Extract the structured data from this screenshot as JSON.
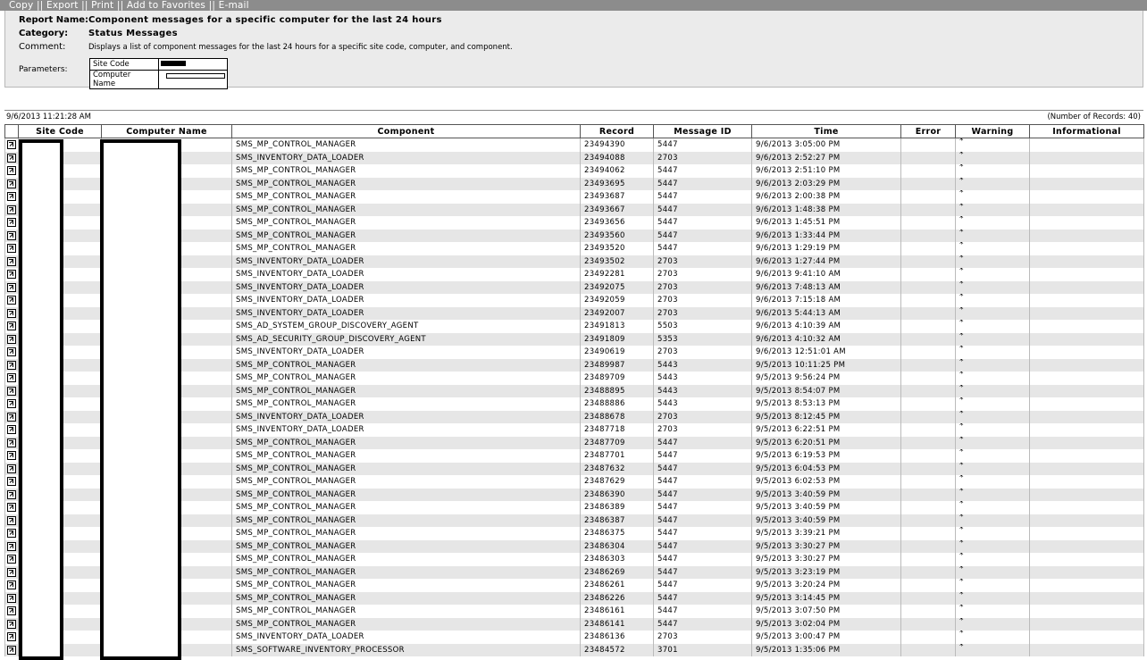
{
  "toolbar": {
    "copy": "Copy",
    "export": "Export",
    "print": "Print",
    "add_to_favorites": "Add to Favorites",
    "email": "E-mail",
    "separator": "||"
  },
  "report": {
    "name_label": "Report Name:",
    "name": "Component messages for a specific computer for the last 24 hours",
    "category_label": "Category:",
    "category": "Status Messages",
    "comment_label": "Comment:",
    "comment": "Displays a list of component messages for the last 24 hours for a specific site code, computer, and component.",
    "parameters_label": "Parameters:",
    "parameters": [
      {
        "label": "Site Code"
      },
      {
        "label": "Computer Name"
      }
    ]
  },
  "meta": {
    "timestamp": "9/6/2013 11:21:28 AM",
    "records": "(Number of Records: 40)"
  },
  "table": {
    "columns": [
      "Site Code",
      "Computer Name",
      "Component",
      "Record",
      "Message ID",
      "Time",
      "Error",
      "Warning",
      "Informational"
    ],
    "warning_mark": "*",
    "rows": [
      {
        "component": "SMS_MP_CONTROL_MANAGER",
        "record": "23494390",
        "message_id": "5447",
        "time": "9/6/2013 3:05:00 PM"
      },
      {
        "component": "SMS_INVENTORY_DATA_LOADER",
        "record": "23494088",
        "message_id": "2703",
        "time": "9/6/2013 2:52:27 PM"
      },
      {
        "component": "SMS_MP_CONTROL_MANAGER",
        "record": "23494062",
        "message_id": "5447",
        "time": "9/6/2013 2:51:10 PM"
      },
      {
        "component": "SMS_MP_CONTROL_MANAGER",
        "record": "23493695",
        "message_id": "5447",
        "time": "9/6/2013 2:03:29 PM"
      },
      {
        "component": "SMS_MP_CONTROL_MANAGER",
        "record": "23493687",
        "message_id": "5447",
        "time": "9/6/2013 2:00:38 PM"
      },
      {
        "component": "SMS_MP_CONTROL_MANAGER",
        "record": "23493667",
        "message_id": "5447",
        "time": "9/6/2013 1:48:38 PM"
      },
      {
        "component": "SMS_MP_CONTROL_MANAGER",
        "record": "23493656",
        "message_id": "5447",
        "time": "9/6/2013 1:45:51 PM"
      },
      {
        "component": "SMS_MP_CONTROL_MANAGER",
        "record": "23493560",
        "message_id": "5447",
        "time": "9/6/2013 1:33:44 PM"
      },
      {
        "component": "SMS_MP_CONTROL_MANAGER",
        "record": "23493520",
        "message_id": "5447",
        "time": "9/6/2013 1:29:19 PM"
      },
      {
        "component": "SMS_INVENTORY_DATA_LOADER",
        "record": "23493502",
        "message_id": "2703",
        "time": "9/6/2013 1:27:44 PM"
      },
      {
        "component": "SMS_INVENTORY_DATA_LOADER",
        "record": "23492281",
        "message_id": "2703",
        "time": "9/6/2013 9:41:10 AM"
      },
      {
        "component": "SMS_INVENTORY_DATA_LOADER",
        "record": "23492075",
        "message_id": "2703",
        "time": "9/6/2013 7:48:13 AM"
      },
      {
        "component": "SMS_INVENTORY_DATA_LOADER",
        "record": "23492059",
        "message_id": "2703",
        "time": "9/6/2013 7:15:18 AM"
      },
      {
        "component": "SMS_INVENTORY_DATA_LOADER",
        "record": "23492007",
        "message_id": "2703",
        "time": "9/6/2013 5:44:13 AM"
      },
      {
        "component": "SMS_AD_SYSTEM_GROUP_DISCOVERY_AGENT",
        "record": "23491813",
        "message_id": "5503",
        "time": "9/6/2013 4:10:39 AM"
      },
      {
        "component": "SMS_AD_SECURITY_GROUP_DISCOVERY_AGENT",
        "record": "23491809",
        "message_id": "5353",
        "time": "9/6/2013 4:10:32 AM"
      },
      {
        "component": "SMS_INVENTORY_DATA_LOADER",
        "record": "23490619",
        "message_id": "2703",
        "time": "9/6/2013 12:51:01 AM"
      },
      {
        "component": "SMS_MP_CONTROL_MANAGER",
        "record": "23489987",
        "message_id": "5443",
        "time": "9/5/2013 10:11:25 PM"
      },
      {
        "component": "SMS_MP_CONTROL_MANAGER",
        "record": "23489709",
        "message_id": "5443",
        "time": "9/5/2013 9:56:24 PM"
      },
      {
        "component": "SMS_MP_CONTROL_MANAGER",
        "record": "23488895",
        "message_id": "5443",
        "time": "9/5/2013 8:54:07 PM"
      },
      {
        "component": "SMS_MP_CONTROL_MANAGER",
        "record": "23488886",
        "message_id": "5443",
        "time": "9/5/2013 8:53:13 PM"
      },
      {
        "component": "SMS_INVENTORY_DATA_LOADER",
        "record": "23488678",
        "message_id": "2703",
        "time": "9/5/2013 8:12:45 PM"
      },
      {
        "component": "SMS_INVENTORY_DATA_LOADER",
        "record": "23487718",
        "message_id": "2703",
        "time": "9/5/2013 6:22:51 PM"
      },
      {
        "component": "SMS_MP_CONTROL_MANAGER",
        "record": "23487709",
        "message_id": "5447",
        "time": "9/5/2013 6:20:51 PM"
      },
      {
        "component": "SMS_MP_CONTROL_MANAGER",
        "record": "23487701",
        "message_id": "5447",
        "time": "9/5/2013 6:19:53 PM"
      },
      {
        "component": "SMS_MP_CONTROL_MANAGER",
        "record": "23487632",
        "message_id": "5447",
        "time": "9/5/2013 6:04:53 PM"
      },
      {
        "component": "SMS_MP_CONTROL_MANAGER",
        "record": "23487629",
        "message_id": "5447",
        "time": "9/5/2013 6:02:53 PM"
      },
      {
        "component": "SMS_MP_CONTROL_MANAGER",
        "record": "23486390",
        "message_id": "5447",
        "time": "9/5/2013 3:40:59 PM"
      },
      {
        "component": "SMS_MP_CONTROL_MANAGER",
        "record": "23486389",
        "message_id": "5447",
        "time": "9/5/2013 3:40:59 PM"
      },
      {
        "component": "SMS_MP_CONTROL_MANAGER",
        "record": "23486387",
        "message_id": "5447",
        "time": "9/5/2013 3:40:59 PM"
      },
      {
        "component": "SMS_MP_CONTROL_MANAGER",
        "record": "23486375",
        "message_id": "5447",
        "time": "9/5/2013 3:39:21 PM"
      },
      {
        "component": "SMS_MP_CONTROL_MANAGER",
        "record": "23486304",
        "message_id": "5447",
        "time": "9/5/2013 3:30:27 PM"
      },
      {
        "component": "SMS_MP_CONTROL_MANAGER",
        "record": "23486303",
        "message_id": "5447",
        "time": "9/5/2013 3:30:27 PM"
      },
      {
        "component": "SMS_MP_CONTROL_MANAGER",
        "record": "23486269",
        "message_id": "5447",
        "time": "9/5/2013 3:23:19 PM"
      },
      {
        "component": "SMS_MP_CONTROL_MANAGER",
        "record": "23486261",
        "message_id": "5447",
        "time": "9/5/2013 3:20:24 PM"
      },
      {
        "component": "SMS_MP_CONTROL_MANAGER",
        "record": "23486226",
        "message_id": "5447",
        "time": "9/5/2013 3:14:45 PM"
      },
      {
        "component": "SMS_MP_CONTROL_MANAGER",
        "record": "23486161",
        "message_id": "5447",
        "time": "9/5/2013 3:07:50 PM"
      },
      {
        "component": "SMS_MP_CONTROL_MANAGER",
        "record": "23486141",
        "message_id": "5447",
        "time": "9/5/2013 3:02:04 PM"
      },
      {
        "component": "SMS_INVENTORY_DATA_LOADER",
        "record": "23486136",
        "message_id": "2703",
        "time": "9/5/2013 3:00:47 PM"
      },
      {
        "component": "SMS_SOFTWARE_INVENTORY_PROCESSOR",
        "record": "23484572",
        "message_id": "3701",
        "time": "9/5/2013 1:35:06 PM"
      }
    ]
  }
}
